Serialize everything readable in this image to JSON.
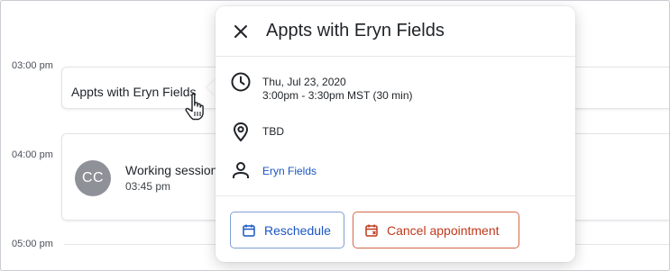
{
  "calendar": {
    "times": [
      "03:00 pm",
      "04:00 pm",
      "05:00 pm"
    ],
    "events": [
      {
        "title": "Appts with Eryn Fields"
      },
      {
        "avatar_initials": "CC",
        "title": "Working session",
        "time": "03:45 pm"
      }
    ]
  },
  "popover": {
    "title": "Appts with Eryn Fields",
    "date": "Thu, Jul 23, 2020",
    "time_range": "3:00pm - 3:30pm MST (30 min)",
    "location": "TBD",
    "person": "Eryn Fields",
    "buttons": {
      "reschedule": "Reschedule",
      "cancel": "Cancel appointment"
    }
  },
  "colors": {
    "link": "#1a56c2",
    "cancel": "#c0391b",
    "avatar": "#8e9197"
  },
  "icons": [
    "close-icon",
    "clock-icon",
    "location-pin-icon",
    "person-icon",
    "calendar-icon",
    "calendar-cancel-icon",
    "hand-pointer-icon"
  ]
}
